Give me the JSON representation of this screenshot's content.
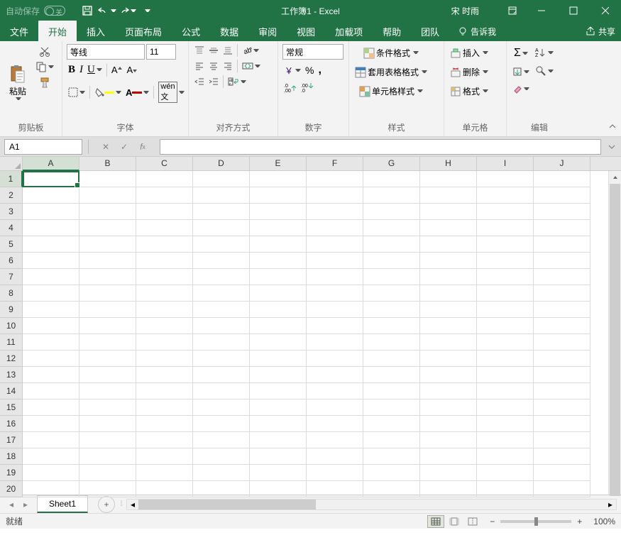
{
  "title": {
    "autosave": "自动保存",
    "autosave_state": "关",
    "doc": "工作簿1  -  Excel",
    "user": "宋 时雨"
  },
  "tabs": {
    "file": "文件",
    "home": "开始",
    "insert": "插入",
    "layout": "页面布局",
    "formula": "公式",
    "data": "数据",
    "review": "审阅",
    "view": "视图",
    "addins": "加载项",
    "help": "帮助",
    "team": "团队",
    "tellme": "告诉我",
    "share": "共享"
  },
  "ribbon": {
    "clipboard": {
      "label": "剪贴板",
      "paste": "粘贴"
    },
    "font": {
      "label": "字体",
      "name": "等线",
      "size": "11"
    },
    "align": {
      "label": "对齐方式"
    },
    "number": {
      "label": "数字",
      "format": "常规"
    },
    "styles": {
      "label": "样式",
      "cond": "条件格式",
      "table": "套用表格格式",
      "cell": "单元格样式"
    },
    "cells": {
      "label": "单元格",
      "insert": "插入",
      "delete": "删除",
      "format": "格式"
    },
    "editing": {
      "label": "编辑"
    }
  },
  "namebox": "A1",
  "columns": [
    "A",
    "B",
    "C",
    "D",
    "E",
    "F",
    "G",
    "H",
    "I",
    "J"
  ],
  "rows": [
    "1",
    "2",
    "3",
    "4",
    "5",
    "6",
    "7",
    "8",
    "9",
    "10",
    "11",
    "12",
    "13",
    "14",
    "15",
    "16",
    "17",
    "18",
    "19",
    "20"
  ],
  "sheet": {
    "name": "Sheet1"
  },
  "status": {
    "ready": "就绪",
    "zoom": "100%"
  }
}
